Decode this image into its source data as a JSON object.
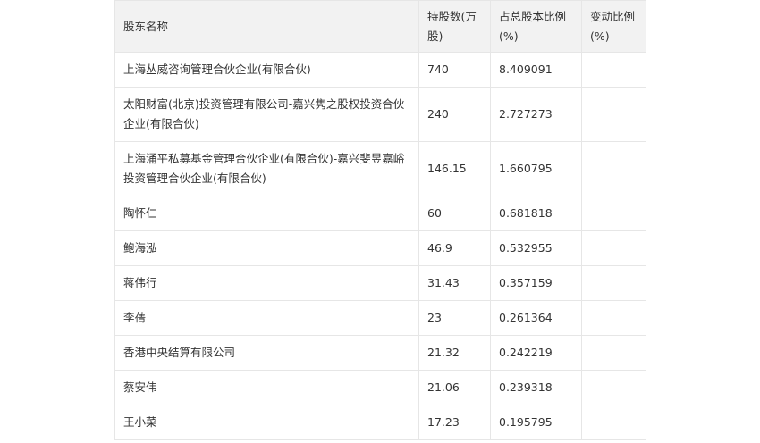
{
  "table": {
    "headers": [
      "股东名称",
      "持股数(万股)",
      "占总股本比例(%)",
      "变动比例(%)"
    ],
    "rows": [
      [
        "上海丛威咨询管理合伙企业(有限合伙)",
        "740",
        "8.409091",
        ""
      ],
      [
        "太阳财富(北京)投资管理有限公司-嘉兴隽之股权投资合伙企业(有限合伙)",
        "240",
        "2.727273",
        ""
      ],
      [
        "上海涌平私募基金管理合伙企业(有限合伙)-嘉兴斐昱嘉峪投资管理合伙企业(有限合伙)",
        "146.15",
        "1.660795",
        ""
      ],
      [
        "陶怀仁",
        "60",
        "0.681818",
        ""
      ],
      [
        "鲍海泓",
        "46.9",
        "0.532955",
        ""
      ],
      [
        "蒋伟行",
        "31.43",
        "0.357159",
        ""
      ],
      [
        "李蒨",
        "23",
        "0.261364",
        ""
      ],
      [
        "香港中央结算有限公司",
        "21.32",
        "0.242219",
        ""
      ],
      [
        "蔡安伟",
        "21.06",
        "0.239318",
        ""
      ],
      [
        "王小菜",
        "17.23",
        "0.195795",
        ""
      ]
    ]
  }
}
